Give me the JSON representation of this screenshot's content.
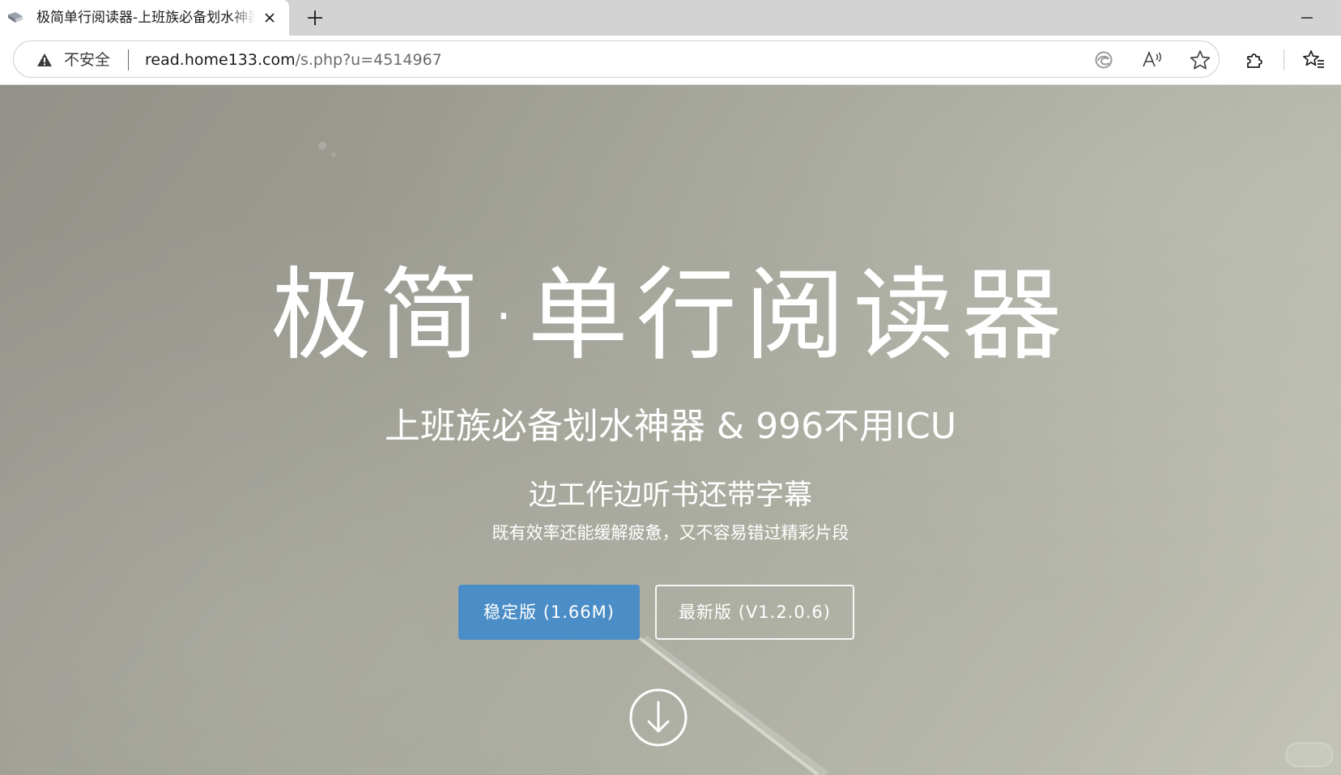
{
  "browser": {
    "tab": {
      "title": "极简单行阅读器-上班族必备划水神器",
      "favicon": "book-icon"
    },
    "address_bar": {
      "security_label": "不安全",
      "url_host": "read.home133.com",
      "url_path": "/s.php?u=4514967"
    },
    "icons": {
      "warning": "warning-triangle-icon",
      "tracking": "edge-tracking-icon",
      "read_aloud": "read-aloud-icon",
      "favorite": "star-icon",
      "extensions": "puzzle-icon",
      "favorites_bar": "favorites-icon",
      "close": "close-icon",
      "new_tab": "plus-icon",
      "minimize": "minimize-icon"
    }
  },
  "hero": {
    "title": "极简·单行阅读器",
    "subtitle": "上班族必备划水神器 & 996不用ICU",
    "tagline": "边工作边听书还带字幕",
    "description": "既有效率还能缓解疲惫，又不容易错过精彩片段",
    "buttons": {
      "stable": "稳定版 (1.66M)",
      "latest": "最新版 (V1.2.0.6)"
    },
    "scroll_icon": "arrow-down-circle-icon"
  },
  "colors": {
    "primary_button": "#4b8dc6",
    "background_tone": "#a2a397",
    "tabstrip": "#d3d3d3",
    "text_on_hero": "#ffffff"
  }
}
